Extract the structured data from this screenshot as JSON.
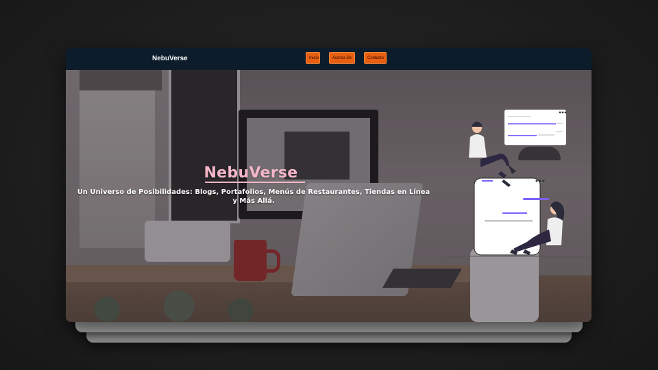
{
  "navbar": {
    "brand": "NebuVerse",
    "links": [
      "Inicio",
      "Acerca De",
      "Contacto"
    ]
  },
  "hero": {
    "title": "NebuVerse",
    "subtitle": "Un Universo de Posibilidades: Blogs, Portafolios, Menús de Restaurantes, Tiendas en Línea y Más Allá."
  },
  "colors": {
    "navbar_bg": "#0c1c2b",
    "nav_button": "#e85f12",
    "title_pink": "#f4b6c8",
    "accent_purple": "#7b61ff"
  },
  "icons": [
    "window-dots-icon",
    "people-illustration"
  ]
}
